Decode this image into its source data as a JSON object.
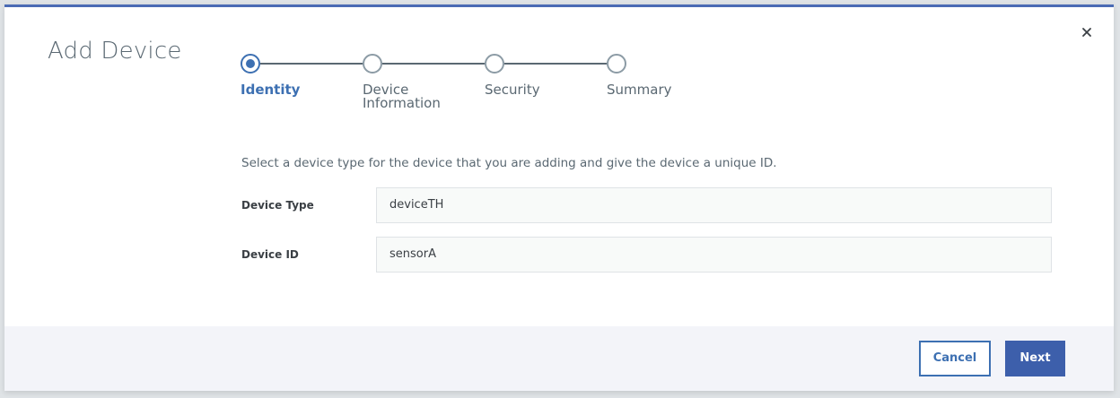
{
  "dialog": {
    "title": "Add Device",
    "close_icon": "close-icon"
  },
  "stepper": {
    "steps": [
      {
        "label": "Identity",
        "state": "active"
      },
      {
        "label": "Device\nInformation",
        "state": "pending"
      },
      {
        "label": "Security",
        "state": "pending"
      },
      {
        "label": "Summary",
        "state": "pending"
      }
    ]
  },
  "form": {
    "description": "Select a device type for the device that you are adding and give the device a unique ID.",
    "device_type": {
      "label": "Device Type",
      "value": "deviceTH"
    },
    "device_id": {
      "label": "Device ID",
      "value": "sensorA"
    }
  },
  "footer": {
    "cancel_label": "Cancel",
    "next_label": "Next"
  },
  "colors": {
    "accent": "#3d70b2",
    "primary_button": "#3d5fab",
    "top_border": "#4a6bb5"
  }
}
